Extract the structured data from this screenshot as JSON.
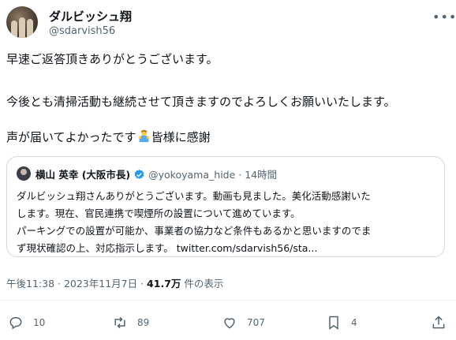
{
  "author": {
    "name": "ダルビッシュ翔",
    "handle": "@sdarvish56"
  },
  "tweet": {
    "line1": "早速ご返答頂きありがとうございます。",
    "line2": "今後とも清掃活動も継続させて頂きますのでよろしくお願いいたします。",
    "line3_before": "声が届いてよかったです",
    "line3_after": "皆様に感謝"
  },
  "quoted": {
    "name": "横山 英幸 (大阪市長)",
    "handle": "@yokoyama_hide",
    "time": "· 14時間",
    "lines": [
      "ダルビッシュ翔さんありがとうございます。動画も見ました。美化活動感謝いた",
      "します。現在、官民連携で喫煙所の設置について進めています。",
      "パーキングでの設置が可能か、事業者の協力など条件もあるかと思いますのでま",
      "ず現状確認の上、対応指示します。 twitter.com/sdarvish56/sta..."
    ]
  },
  "meta": {
    "timestamp": "午後11:38 · 2023年11月7日 · ",
    "views": "41.7万",
    "views_suffix": " 件の表示"
  },
  "actions": {
    "replies": "10",
    "retweets": "89",
    "likes": "707",
    "bookmarks": "4"
  },
  "colors": {
    "text": "#0f1419",
    "secondary": "#536471",
    "verified": "#1d9bf0",
    "border": "#cfd9de"
  }
}
